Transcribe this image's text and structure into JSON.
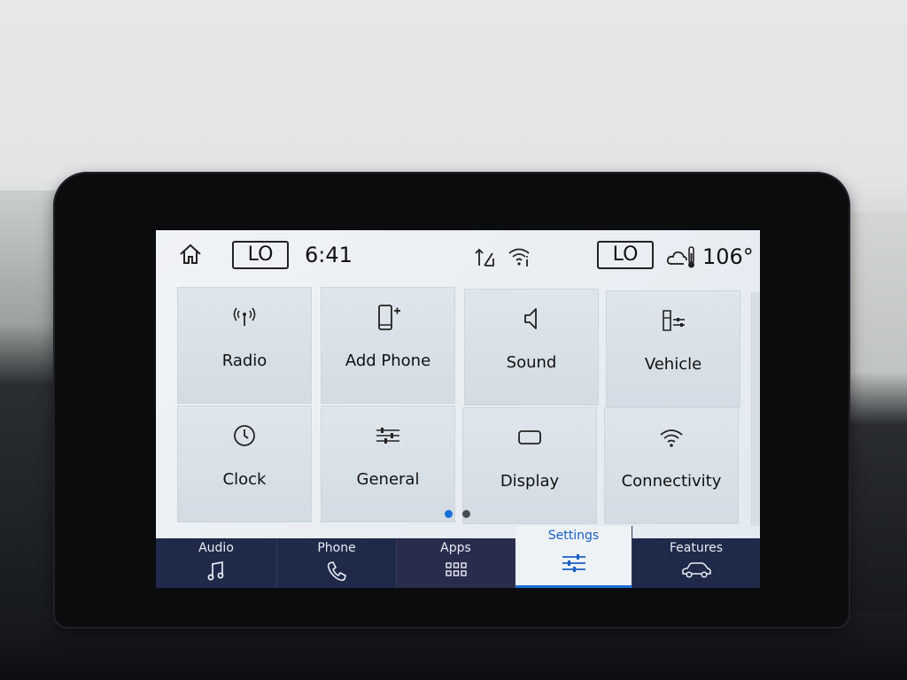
{
  "status_bar": {
    "climate_left": "LO",
    "time": "6:41",
    "climate_right": "LO",
    "outside_temp": "106°"
  },
  "tiles": [
    {
      "label": "Radio",
      "icon": "radio-antenna-icon"
    },
    {
      "label": "Add Phone",
      "icon": "add-phone-icon"
    },
    {
      "label": "Sound",
      "icon": "speaker-icon"
    },
    {
      "label": "Vehicle",
      "icon": "vehicle-settings-icon"
    },
    {
      "label": "Clock",
      "icon": "clock-icon"
    },
    {
      "label": "General",
      "icon": "sliders-icon"
    },
    {
      "label": "Display",
      "icon": "display-icon"
    },
    {
      "label": "Connectivity",
      "icon": "wifi-icon"
    }
  ],
  "pager": {
    "pages": 2,
    "current": 1
  },
  "nav": [
    {
      "label": "Audio",
      "icon": "music-note-icon"
    },
    {
      "label": "Phone",
      "icon": "phone-handset-icon"
    },
    {
      "label": "Apps",
      "icon": "apps-grid-icon"
    },
    {
      "label": "Settings",
      "icon": "settings-sliders-icon",
      "active": true
    },
    {
      "label": "Features",
      "icon": "car-icon"
    }
  ],
  "colors": {
    "accent": "#1a6fd6",
    "nav_background": "#1f2a4a",
    "screen_background": "#e8eef3"
  }
}
